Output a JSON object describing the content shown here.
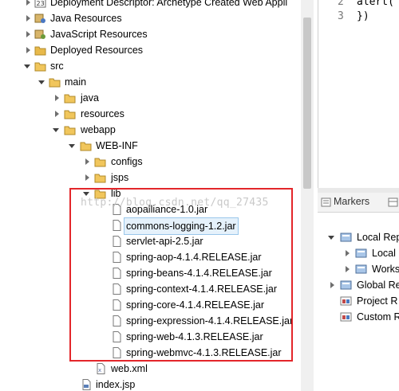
{
  "explorer": {
    "items": [
      {
        "label": "Deployment Descriptor: Archetype Created Web Appli",
        "icon": "deployment-descriptor-icon",
        "twisty": "closed"
      },
      {
        "label": "Java Resources",
        "icon": "java-resources-icon",
        "twisty": "closed"
      },
      {
        "label": "JavaScript Resources",
        "icon": "javascript-resources-icon",
        "twisty": "closed"
      },
      {
        "label": "Deployed Resources",
        "icon": "deployed-resources-icon",
        "twisty": "closed"
      },
      {
        "label": "src",
        "icon": "folder-icon",
        "twisty": "open"
      },
      {
        "label": "main",
        "icon": "folder-icon",
        "twisty": "open"
      },
      {
        "label": "java",
        "icon": "folder-icon",
        "twisty": "closed"
      },
      {
        "label": "resources",
        "icon": "folder-icon",
        "twisty": "closed"
      },
      {
        "label": "webapp",
        "icon": "folder-icon",
        "twisty": "open"
      },
      {
        "label": "WEB-INF",
        "icon": "folder-icon",
        "twisty": "open"
      },
      {
        "label": "configs",
        "icon": "folder-icon",
        "twisty": "closed"
      },
      {
        "label": "jsps",
        "icon": "folder-icon",
        "twisty": "closed"
      },
      {
        "label": "lib",
        "icon": "folder-icon",
        "twisty": "open"
      },
      {
        "label": "aopalliance-1.0.jar",
        "icon": "jar-file-icon",
        "twisty": "none"
      },
      {
        "label": "commons-logging-1.2.jar",
        "icon": "jar-file-icon",
        "twisty": "none",
        "selected": true
      },
      {
        "label": "servlet-api-2.5.jar",
        "icon": "jar-file-icon",
        "twisty": "none"
      },
      {
        "label": "spring-aop-4.1.4.RELEASE.jar",
        "icon": "jar-file-icon",
        "twisty": "none"
      },
      {
        "label": "spring-beans-4.1.4.RELEASE.jar",
        "icon": "jar-file-icon",
        "twisty": "none"
      },
      {
        "label": "spring-context-4.1.4.RELEASE.jar",
        "icon": "jar-file-icon",
        "twisty": "none"
      },
      {
        "label": "spring-core-4.1.4.RELEASE.jar",
        "icon": "jar-file-icon",
        "twisty": "none"
      },
      {
        "label": "spring-expression-4.1.4.RELEASE.jar",
        "icon": "jar-file-icon",
        "twisty": "none"
      },
      {
        "label": "spring-web-4.1.3.RELEASE.jar",
        "icon": "jar-file-icon",
        "twisty": "none"
      },
      {
        "label": "spring-webmvc-4.1.3.RELEASE.jar",
        "icon": "jar-file-icon",
        "twisty": "none"
      },
      {
        "label": "web.xml",
        "icon": "xml-file-icon",
        "twisty": "none"
      },
      {
        "label": "index.jsp",
        "icon": "jsp-file-icon",
        "twisty": "none"
      }
    ]
  },
  "editor": {
    "lines": [
      {
        "number": "2",
        "code": "alert("
      },
      {
        "number": "3",
        "code": "})"
      }
    ]
  },
  "markers": {
    "tab_label": "Markers",
    "items": [
      {
        "label": "Local Rep",
        "icon": "server-icon",
        "twisty": "open"
      },
      {
        "label": "Local",
        "icon": "server-icon",
        "twisty": "closed"
      },
      {
        "label": "Works",
        "icon": "server-icon",
        "twisty": "closed"
      },
      {
        "label": "Global Re",
        "icon": "server-icon",
        "twisty": "closed"
      },
      {
        "label": "Project R",
        "icon": "project-icon",
        "twisty": "none"
      },
      {
        "label": "Custom R",
        "icon": "project-icon",
        "twisty": "none"
      }
    ]
  },
  "watermark": "http://blog.csdn.net/qq_27435",
  "colors": {
    "annotation_box": "#e3262a",
    "selection_bg": "#e5f1fb",
    "folder": "#e8b94a"
  }
}
